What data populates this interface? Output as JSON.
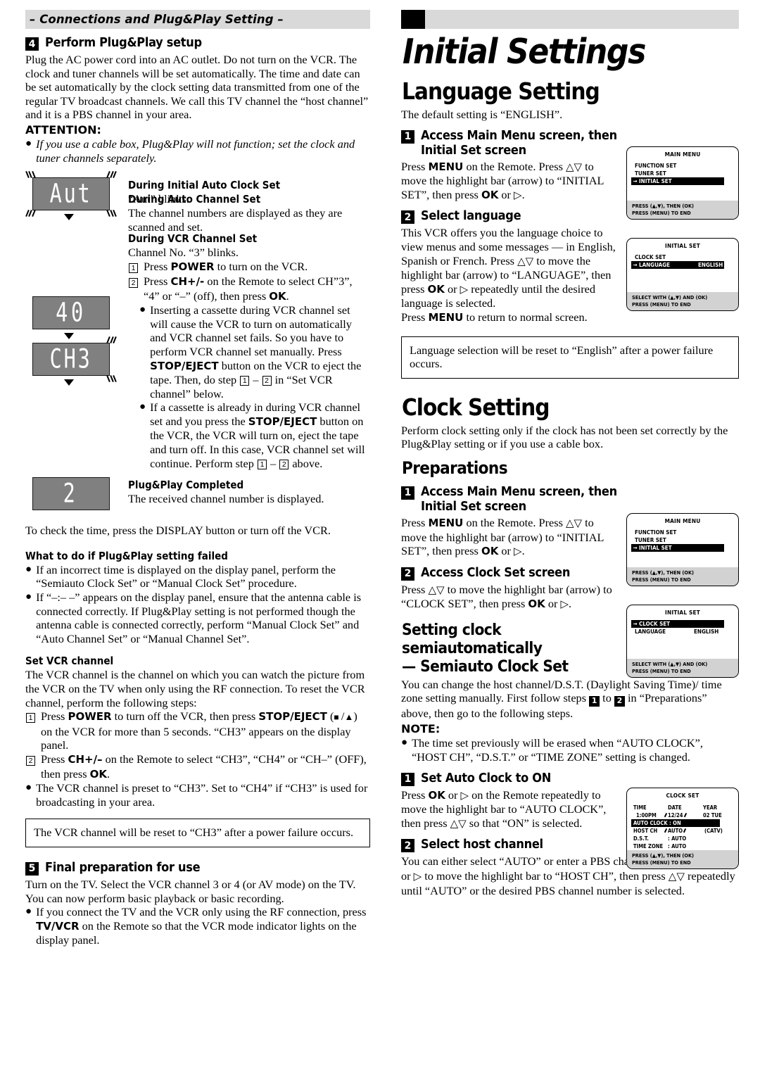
{
  "left": {
    "banner": "– Connections and Plug&Play Setting –",
    "step4": {
      "num": "4",
      "title": "Perform Plug&Play setup",
      "body": "Plug the AC power cord into an AC outlet. Do not turn on the VCR. The clock and tuner channels will be set automatically. The time and date can be set automatically by the clock setting data transmitted from one of the regular TV broadcast channels. We call this TV channel the “host channel” and it is a PBS channel in your area."
    },
    "attention": {
      "heading": "ATTENTION:",
      "bullet": "If you use a cable box, Plug&Play will not function; set the clock and tuner channels separately."
    },
    "lcd_sequence": [
      {
        "display": "Aut",
        "blink": true,
        "heading": "During Initial Auto Clock Set",
        "body": "“Aut” blinks."
      },
      {
        "display": "40",
        "blink": false,
        "heading": "During Auto Channel Set",
        "body": "The channel numbers are displayed as they are scanned and set."
      },
      {
        "display": "CH3",
        "blink": true,
        "heading": "During VCR Channel Set",
        "body": "Channel No. “3” blinks."
      },
      {
        "display": "2",
        "blink": false,
        "heading": "Plug&Play Completed",
        "body": "The received channel number is displayed."
      }
    ],
    "vcr_steps": [
      {
        "num": "1",
        "text": "Press POWER to turn on the VCR."
      },
      {
        "num": "2",
        "text": "Press CH+/- on the Remote to select CH”3”, “4” or “–” (off), then press OK."
      }
    ],
    "vcr_bullets": [
      "Inserting a cassette during VCR channel set will cause the VCR to turn on automatically and VCR channel set fails. So you have to perform VCR channel set manually. Press STOP/EJECT button on the VCR to eject the tape. Then, do step 1 – 2 in “Set VCR channel” below.",
      "If a cassette is already in during VCR channel set and you press the STOP/EJECT button on the VCR, the VCR will turn on, eject the tape and turn off. In this case, VCR channel set will continue. Perform step 1 – 2 above."
    ],
    "check_time": "To check the time, press the DISPLAY button or turn off the VCR.",
    "failed": {
      "heading": "What to do if Plug&Play setting failed",
      "bullets": [
        "If an incorrect time is displayed on the display panel, perform the “Semiauto Clock Set” or “Manual Clock Set” procedure.",
        "If “–:– –” appears on the display panel, ensure that the antenna cable is connected correctly. If Plug&Play setting is not performed though the antenna cable is connected correctly, perform “Manual Clock Set” and “Auto Channel Set” or “Manual Channel Set”."
      ]
    },
    "set_vcr": {
      "heading": "Set VCR channel",
      "body": "The VCR channel is the channel on which you can watch the picture from the VCR on the TV when only using the RF connection. To reset the VCR channel, perform the following steps:",
      "steps": [
        {
          "num": "1",
          "text": "Press POWER to turn off the VCR, then press STOP/EJECT (■/▲) on the VCR for more than 5 seconds. “CH3” appears on the display panel."
        },
        {
          "num": "2",
          "text": "Press CH+/– on the Remote to select “CH3”, “CH4” or “CH–” (OFF), then press OK."
        }
      ],
      "bullet": "The VCR channel is preset to “CH3”. Set to “CH4” if “CH3” is used for broadcasting in your area.",
      "boxnote": "The VCR channel will be reset to “CH3” after a power failure occurs."
    },
    "step5": {
      "num": "5",
      "title": "Final preparation for use",
      "body": "Turn on the TV. Select the VCR channel 3 or 4 (or AV mode) on the TV. You can now perform basic playback or basic recording.",
      "bullet": "If you connect the TV and the VCR only using the RF connection, press TV/VCR on the Remote so that the VCR mode indicator lights on the display panel."
    }
  },
  "right": {
    "page_title": "Initial Settings",
    "language": {
      "title": "Language Setting",
      "intro": "The default setting is “ENGLISH”.",
      "step1": {
        "num": "1",
        "title_line1": "Access Main Menu screen, then",
        "title_line2": "Initial Set screen",
        "body": "Press MENU on the Remote. Press △▽ to move the highlight bar (arrow) to “INITIAL SET”, then press OK or ▷."
      },
      "step2": {
        "num": "2",
        "title": "Select language",
        "body": "This VCR offers you the language choice to view menus and some messages — in English, Spanish or French. Press △▽ to move the highlight bar (arrow) to “LANGUAGE”, then press OK or ▷ repeatedly until the desired language is selected.",
        "body2": "Press MENU to return to normal screen."
      },
      "boxnote": "Language selection will be reset to “English” after a power failure occurs."
    },
    "clock": {
      "title": "Clock Setting",
      "intro": "Perform clock setting only if the clock has not been set correctly by the Plug&Play setting or if you use a cable box.",
      "preparations_title": "Preparations",
      "step1": {
        "num": "1",
        "title_line1": "Access Main Menu screen, then",
        "title_line2": "Initial Set screen",
        "body": "Press MENU on the Remote. Press △▽ to move the highlight bar (arrow) to “INITIAL SET”, then press OK or ▷."
      },
      "step2": {
        "num": "2",
        "title": "Access Clock Set screen",
        "body": "Press △▽ to move the highlight bar (arrow) to “CLOCK SET”, then press OK or ▷."
      },
      "semiauto_title_line1": "Setting clock semiautomatically",
      "semiauto_title_line2": "— Semiauto Clock Set",
      "semiauto_body": "You can change the host channel/D.S.T. (Daylight Saving Time)/ time zone setting manually. First follow steps 1 to 2 in “Preparations” above, then go to the following steps.",
      "note_head": "NOTE:",
      "note_bullet": "The time set previously will be erased when “AUTO CLOCK”, “HOST CH”, “D.S.T.” or “TIME ZONE” setting is changed.",
      "stepA": {
        "num": "1",
        "title": "Set Auto Clock to ON",
        "body": "Press OK or ▷ on the Remote repeatedly to move the highlight bar to “AUTO CLOCK”, then press △▽ so that “ON” is selected."
      },
      "stepB": {
        "num": "2",
        "title": "Select host channel",
        "body": "You can either select “AUTO” or enter a PBS channel number. Press OK or ▷ to move the highlight bar to “HOST CH”, then press △▽ repeatedly until “AUTO” or the desired PBS channel number is selected."
      }
    },
    "menus": {
      "main_menu_1": {
        "title": "MAIN MENU",
        "items": [
          {
            "label": "FUNCTION SET",
            "value": "",
            "highlight": false
          },
          {
            "label": "TUNER SET",
            "value": "",
            "highlight": false
          },
          {
            "label": "INITIAL SET",
            "value": "",
            "highlight": true
          }
        ],
        "footer1": "PRESS (▲,▼), THEN (OK)",
        "footer2": "PRESS (MENU) TO END"
      },
      "initial_set_1": {
        "title": "INITIAL SET",
        "items": [
          {
            "label": "CLOCK SET",
            "value": "",
            "highlight": false
          },
          {
            "label": "LANGUAGE",
            "value": "ENGLISH",
            "highlight": true
          }
        ],
        "footer1": "SELECT WITH (▲,▼) AND (OK)",
        "footer2": "PRESS (MENU) TO END"
      },
      "main_menu_2": {
        "title": "MAIN MENU",
        "items": [
          {
            "label": "FUNCTION SET",
            "value": "",
            "highlight": false
          },
          {
            "label": "TUNER SET",
            "value": "",
            "highlight": false
          },
          {
            "label": "INITIAL SET",
            "value": "",
            "highlight": true
          }
        ],
        "footer1": "PRESS (▲,▼), THEN (OK)",
        "footer2": "PRESS (MENU) TO END"
      },
      "initial_set_2": {
        "title": "INITIAL SET",
        "items": [
          {
            "label": "CLOCK SET",
            "value": "",
            "highlight": true
          },
          {
            "label": "LANGUAGE",
            "value": "ENGLISH",
            "highlight": false
          }
        ],
        "footer1": "SELECT WITH (▲,▼) AND (OK)",
        "footer2": "PRESS (MENU) TO END"
      },
      "clock_set": {
        "title": "CLOCK SET",
        "col_time": "TIME",
        "col_date": "DATE",
        "col_year": "YEAR",
        "time_value": "1:00PM",
        "date_value": "12/24",
        "year_value": "02 TUE",
        "auto_clock_label": "AUTO CLOCK",
        "auto_clock_value": "ON",
        "host_ch_label": "HOST CH",
        "host_ch_value": "AUTO",
        "host_ch_extra": "(CATV)",
        "dst_label": "D.S.T.",
        "dst_value": ": AUTO",
        "tz_label": "TIME ZONE",
        "tz_value": ": AUTO",
        "footer1": "PRESS (▲,▼), THEN (OK)",
        "footer2": "PRESS (MENU) TO END"
      }
    }
  }
}
